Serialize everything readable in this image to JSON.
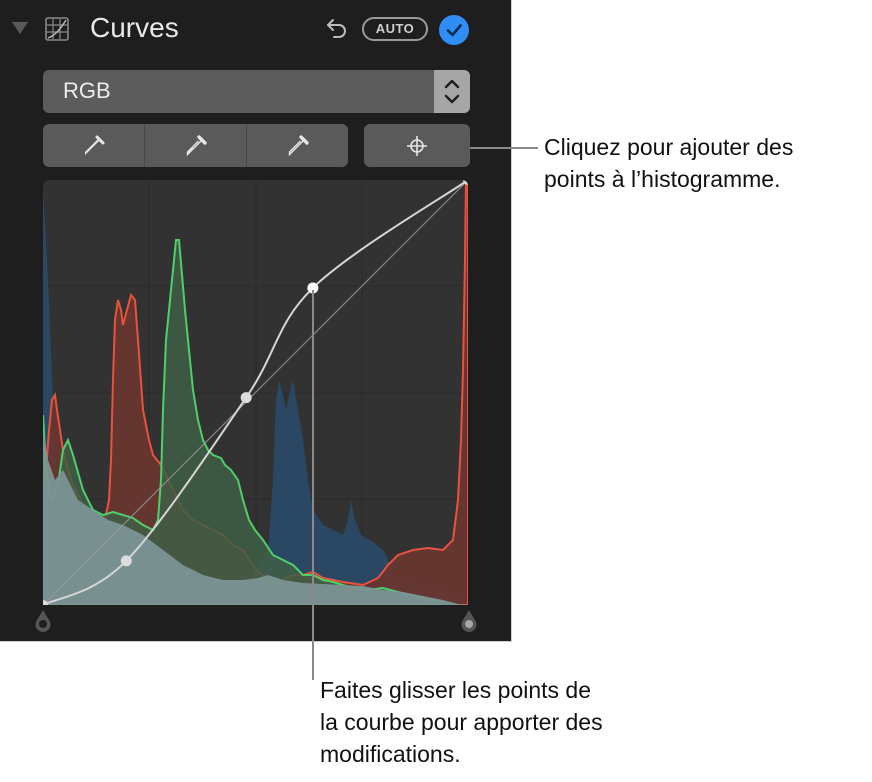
{
  "panel": {
    "title": "Curves",
    "auto_label": "AUTO",
    "icons": {
      "disclosure": "disclosure-triangle-down",
      "section": "curves-grid-icon",
      "undo": "undo-arrow",
      "enabled": "checkmark-circle"
    },
    "enabled": true,
    "channel_select": {
      "selected": "RGB"
    },
    "eyedroppers": [
      {
        "name": "black-point-eyedropper",
        "icon": "eyedropper-filled"
      },
      {
        "name": "gray-point-eyedropper",
        "icon": "eyedropper-half"
      },
      {
        "name": "white-point-eyedropper",
        "icon": "eyedropper-outline"
      }
    ],
    "add_point_button": {
      "icon": "crosshair-target"
    },
    "colors": {
      "accent": "#2f8df5",
      "red_channel": "#e8523e",
      "green_channel": "#4fcf6a",
      "blue_channel": "#2d4e6a",
      "curve": "#d6d6d6"
    },
    "curve_points": [
      {
        "input": 0.0,
        "output": 0.0
      },
      {
        "input": 0.196,
        "output": 0.104
      },
      {
        "input": 0.478,
        "output": 0.488
      },
      {
        "input": 0.635,
        "output": 0.746
      },
      {
        "input": 1.0,
        "output": 1.0
      }
    ]
  },
  "annotations": {
    "add_points": [
      "Cliquez pour ajouter des",
      "points à l’histogramme."
    ],
    "drag_points": [
      "Faites glisser les points de",
      "la courbe pour apporter des",
      "modifications."
    ]
  }
}
